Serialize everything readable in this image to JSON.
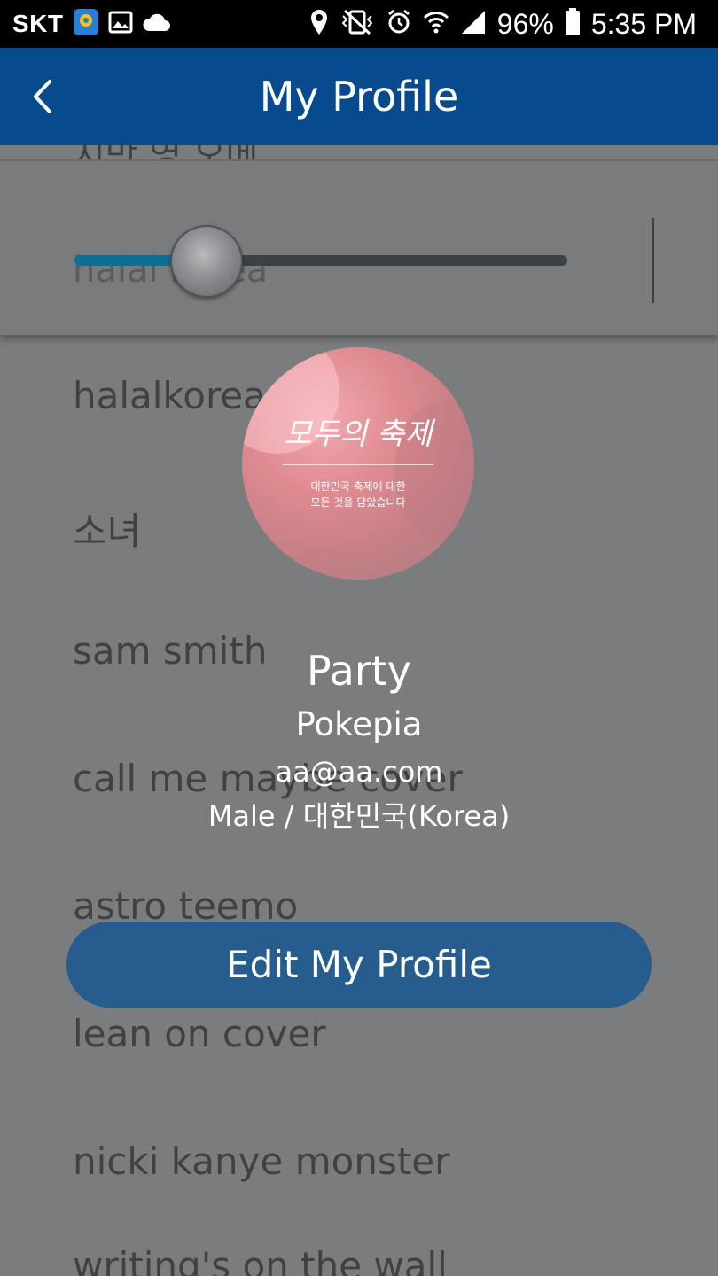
{
  "status_bar": {
    "carrier": "SKT",
    "battery": "96%",
    "time": "5:35 PM",
    "icons": [
      "map-pin-icon",
      "gallery-icon",
      "cloud-icon",
      "location-icon",
      "vibrate-mute-icon",
      "alarm-icon",
      "wifi-icon",
      "signal-icon",
      "battery-icon"
    ]
  },
  "header": {
    "title": "My Profile",
    "back_icon": "chevron-left-icon"
  },
  "background": {
    "top_partial_text": "치만 영 오메",
    "card_partial_text": "halal korea",
    "playlist": [
      "halalkorea",
      "소녀",
      "sam smith",
      "call me maybe cover",
      "astro teemo",
      "lean on cover",
      "nicki kanye monster",
      "writing's on the wall"
    ]
  },
  "profile": {
    "avatar": {
      "title": "모두의 축제",
      "subtitle_line1": "대한민국 축제에 대한",
      "subtitle_line2": "모든 것을 담았습니다"
    },
    "name": "Party",
    "nickname": "Pokepia",
    "email": "aa@aa.com",
    "gender_country": "Male / 대한민국(Korea)"
  },
  "actions": {
    "edit_label": "Edit My Profile"
  },
  "colors": {
    "header_bg": "#074b8e",
    "button_bg": "#265c8e",
    "overlay_bg": "#7b7c7d"
  }
}
